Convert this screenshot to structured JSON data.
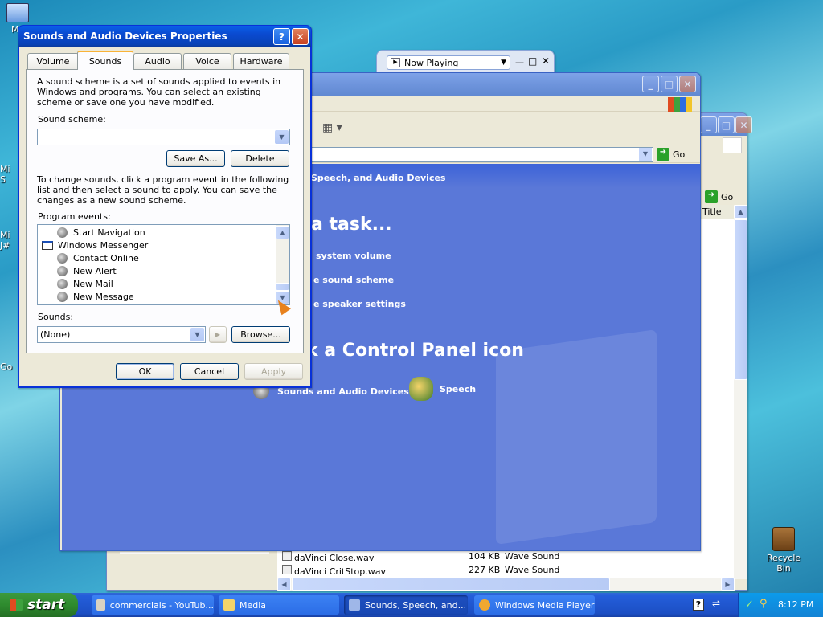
{
  "desktop": {
    "icons": [
      {
        "name": "my-computer",
        "label": "My"
      },
      {
        "name": "mi-icon",
        "label": "Mi S"
      },
      {
        "name": "mi-j-icon",
        "label": "Mi J#"
      },
      {
        "name": "go-icon",
        "label": "Go"
      },
      {
        "name": "recycle-bin",
        "label": "Recycle Bin"
      }
    ]
  },
  "media_player": {
    "title": "Now Playing"
  },
  "control_panel": {
    "header": "Speech, and Audio Devices",
    "go_label": "Go",
    "pick_task": "a task...",
    "tasks": [
      "system volume",
      "e sound scheme",
      "e speaker settings"
    ],
    "pick_icon": "k a Control Panel icon",
    "icons": [
      "Sounds and Audio Devices",
      "Speech"
    ]
  },
  "back_window": {
    "go_label": "Go",
    "col_title": "Title",
    "files": [
      {
        "name": "daVinci Close.wav",
        "size": "104 KB",
        "type": "Wave Sound"
      },
      {
        "name": "daVinci CritStop.wav",
        "size": "227 KB",
        "type": "Wave Sound"
      }
    ]
  },
  "dialog": {
    "title": "Sounds and Audio Devices Properties",
    "tabs": [
      "Volume",
      "Sounds",
      "Audio",
      "Voice",
      "Hardware"
    ],
    "intro": "A sound scheme is a set of sounds applied to events in Windows and programs. You can select an existing scheme or save one you have modified.",
    "scheme_label": "Sound scheme:",
    "scheme_value": "",
    "save_as": "Save As...",
    "delete": "Delete",
    "change_text": "To change sounds, click a program event in the following list and then select a sound to apply. You can save the changes as a new sound scheme.",
    "events_label": "Program events:",
    "events": [
      {
        "label": "Start Navigation",
        "kind": "sound"
      },
      {
        "label": "Windows Messenger",
        "kind": "group"
      },
      {
        "label": "Contact Online",
        "kind": "sound"
      },
      {
        "label": "New Alert",
        "kind": "sound"
      },
      {
        "label": "New Mail",
        "kind": "sound"
      },
      {
        "label": "New Message",
        "kind": "sound"
      }
    ],
    "sounds_label": "Sounds:",
    "sound_value": "(None)",
    "browse": "Browse...",
    "ok": "OK",
    "cancel": "Cancel",
    "apply": "Apply"
  },
  "taskbar": {
    "start": "start",
    "items": [
      {
        "label": "commercials - YouTub...",
        "active": false
      },
      {
        "label": "Media",
        "active": false
      },
      {
        "label": "Sounds, Speech, and...",
        "active": true
      },
      {
        "label": "Windows Media Player",
        "active": false
      }
    ],
    "time": "8:12 PM"
  },
  "colors": {
    "title_blue": "#0a4ad0",
    "panel_blue": "#5a78d8",
    "taskbar_blue": "#245edb",
    "start_green": "#2e8b2e"
  }
}
